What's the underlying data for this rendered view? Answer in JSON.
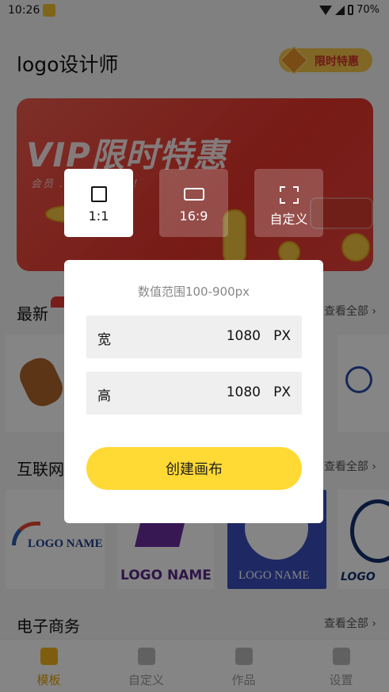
{
  "status_bar": {
    "time": "10:26",
    "battery": "70%"
  },
  "header": {
    "title": "logo设计师",
    "promo_label": "限时特惠"
  },
  "banner": {
    "headline": "VIP限时特惠",
    "subtext": "会员 ... OGO模版！"
  },
  "sections": [
    {
      "title": "最新",
      "see_all": "查看全部 ›"
    },
    {
      "title": "互联网",
      "see_all": "查看全部 ›"
    },
    {
      "title": "电子商务",
      "see_all": "查看全部 ›"
    }
  ],
  "thumbnails": {
    "row2": [
      "LOGO NAME",
      "LOGO NAME",
      "LOGO NAME",
      "LOGO"
    ]
  },
  "nav": [
    {
      "label": "模板",
      "icon": "template-icon",
      "active": true
    },
    {
      "label": "自定义",
      "icon": "custom-icon",
      "active": false
    },
    {
      "label": "作品",
      "icon": "works-icon",
      "active": false
    },
    {
      "label": "设置",
      "icon": "settings-icon",
      "active": false
    }
  ],
  "ratio_options": [
    {
      "label": "1:1",
      "icon": "square-ratio-icon",
      "selected": true
    },
    {
      "label": "16:9",
      "icon": "wide-ratio-icon",
      "selected": false
    },
    {
      "label": "自定义",
      "icon": "custom-size-icon",
      "selected": false
    }
  ],
  "dialog": {
    "hint": "数值范围100-900px",
    "width_label": "宽",
    "width_value": "1080",
    "height_label": "高",
    "height_value": "1080",
    "unit": "PX",
    "create_button": "创建画布"
  },
  "colors": {
    "accent": "#ffd934",
    "nav_active": "#e6a300",
    "banner_red": "#e7342b"
  }
}
